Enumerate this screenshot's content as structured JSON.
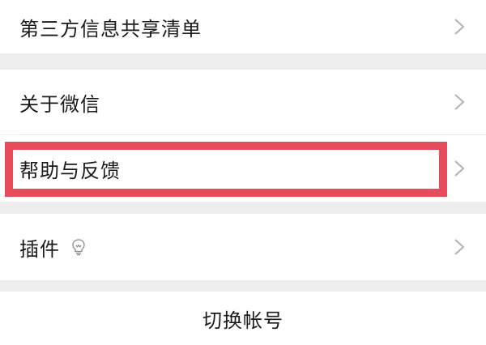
{
  "settings": {
    "items": [
      {
        "label": "第三方信息共享清单"
      },
      {
        "label": "关于微信"
      },
      {
        "label": "帮助与反馈"
      },
      {
        "label": "插件"
      }
    ],
    "switch_account": "切换帐号"
  },
  "icons": {
    "chevron": "chevron-right-icon",
    "plugin_badge": "lightbulb-icon"
  },
  "colors": {
    "highlight": "#e64c5c",
    "background": "#ededed",
    "row": "#ffffff",
    "chevron": "#b2b2b2"
  }
}
